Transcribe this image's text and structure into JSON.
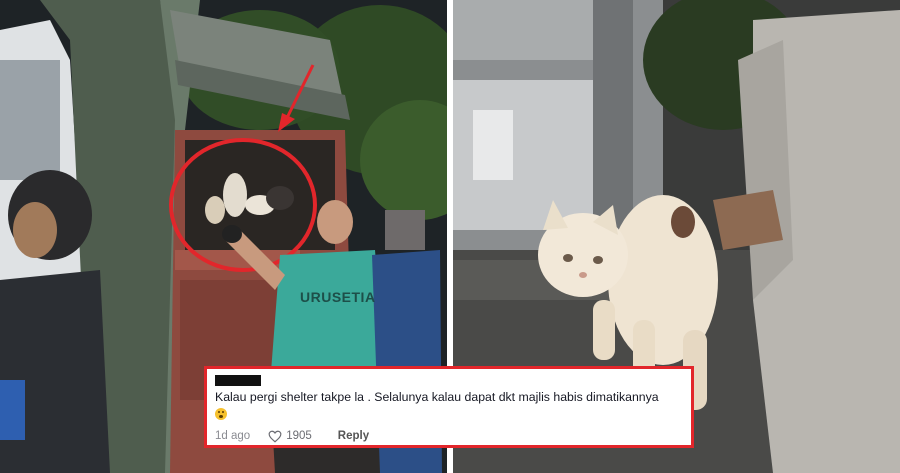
{
  "left_photo": {
    "vest_text": "URUSETIA"
  },
  "comment": {
    "text": "Kalau pergi shelter takpe la . Selalunya kalau dapat dkt majlis habis dimatikannya",
    "emoji": "flushed-face",
    "age": "1d ago",
    "likes": "1905",
    "reply_label": "Reply"
  },
  "colors": {
    "highlight": "#e2262b",
    "vest": "#3ba99a",
    "truck": "#8e4a3f"
  }
}
